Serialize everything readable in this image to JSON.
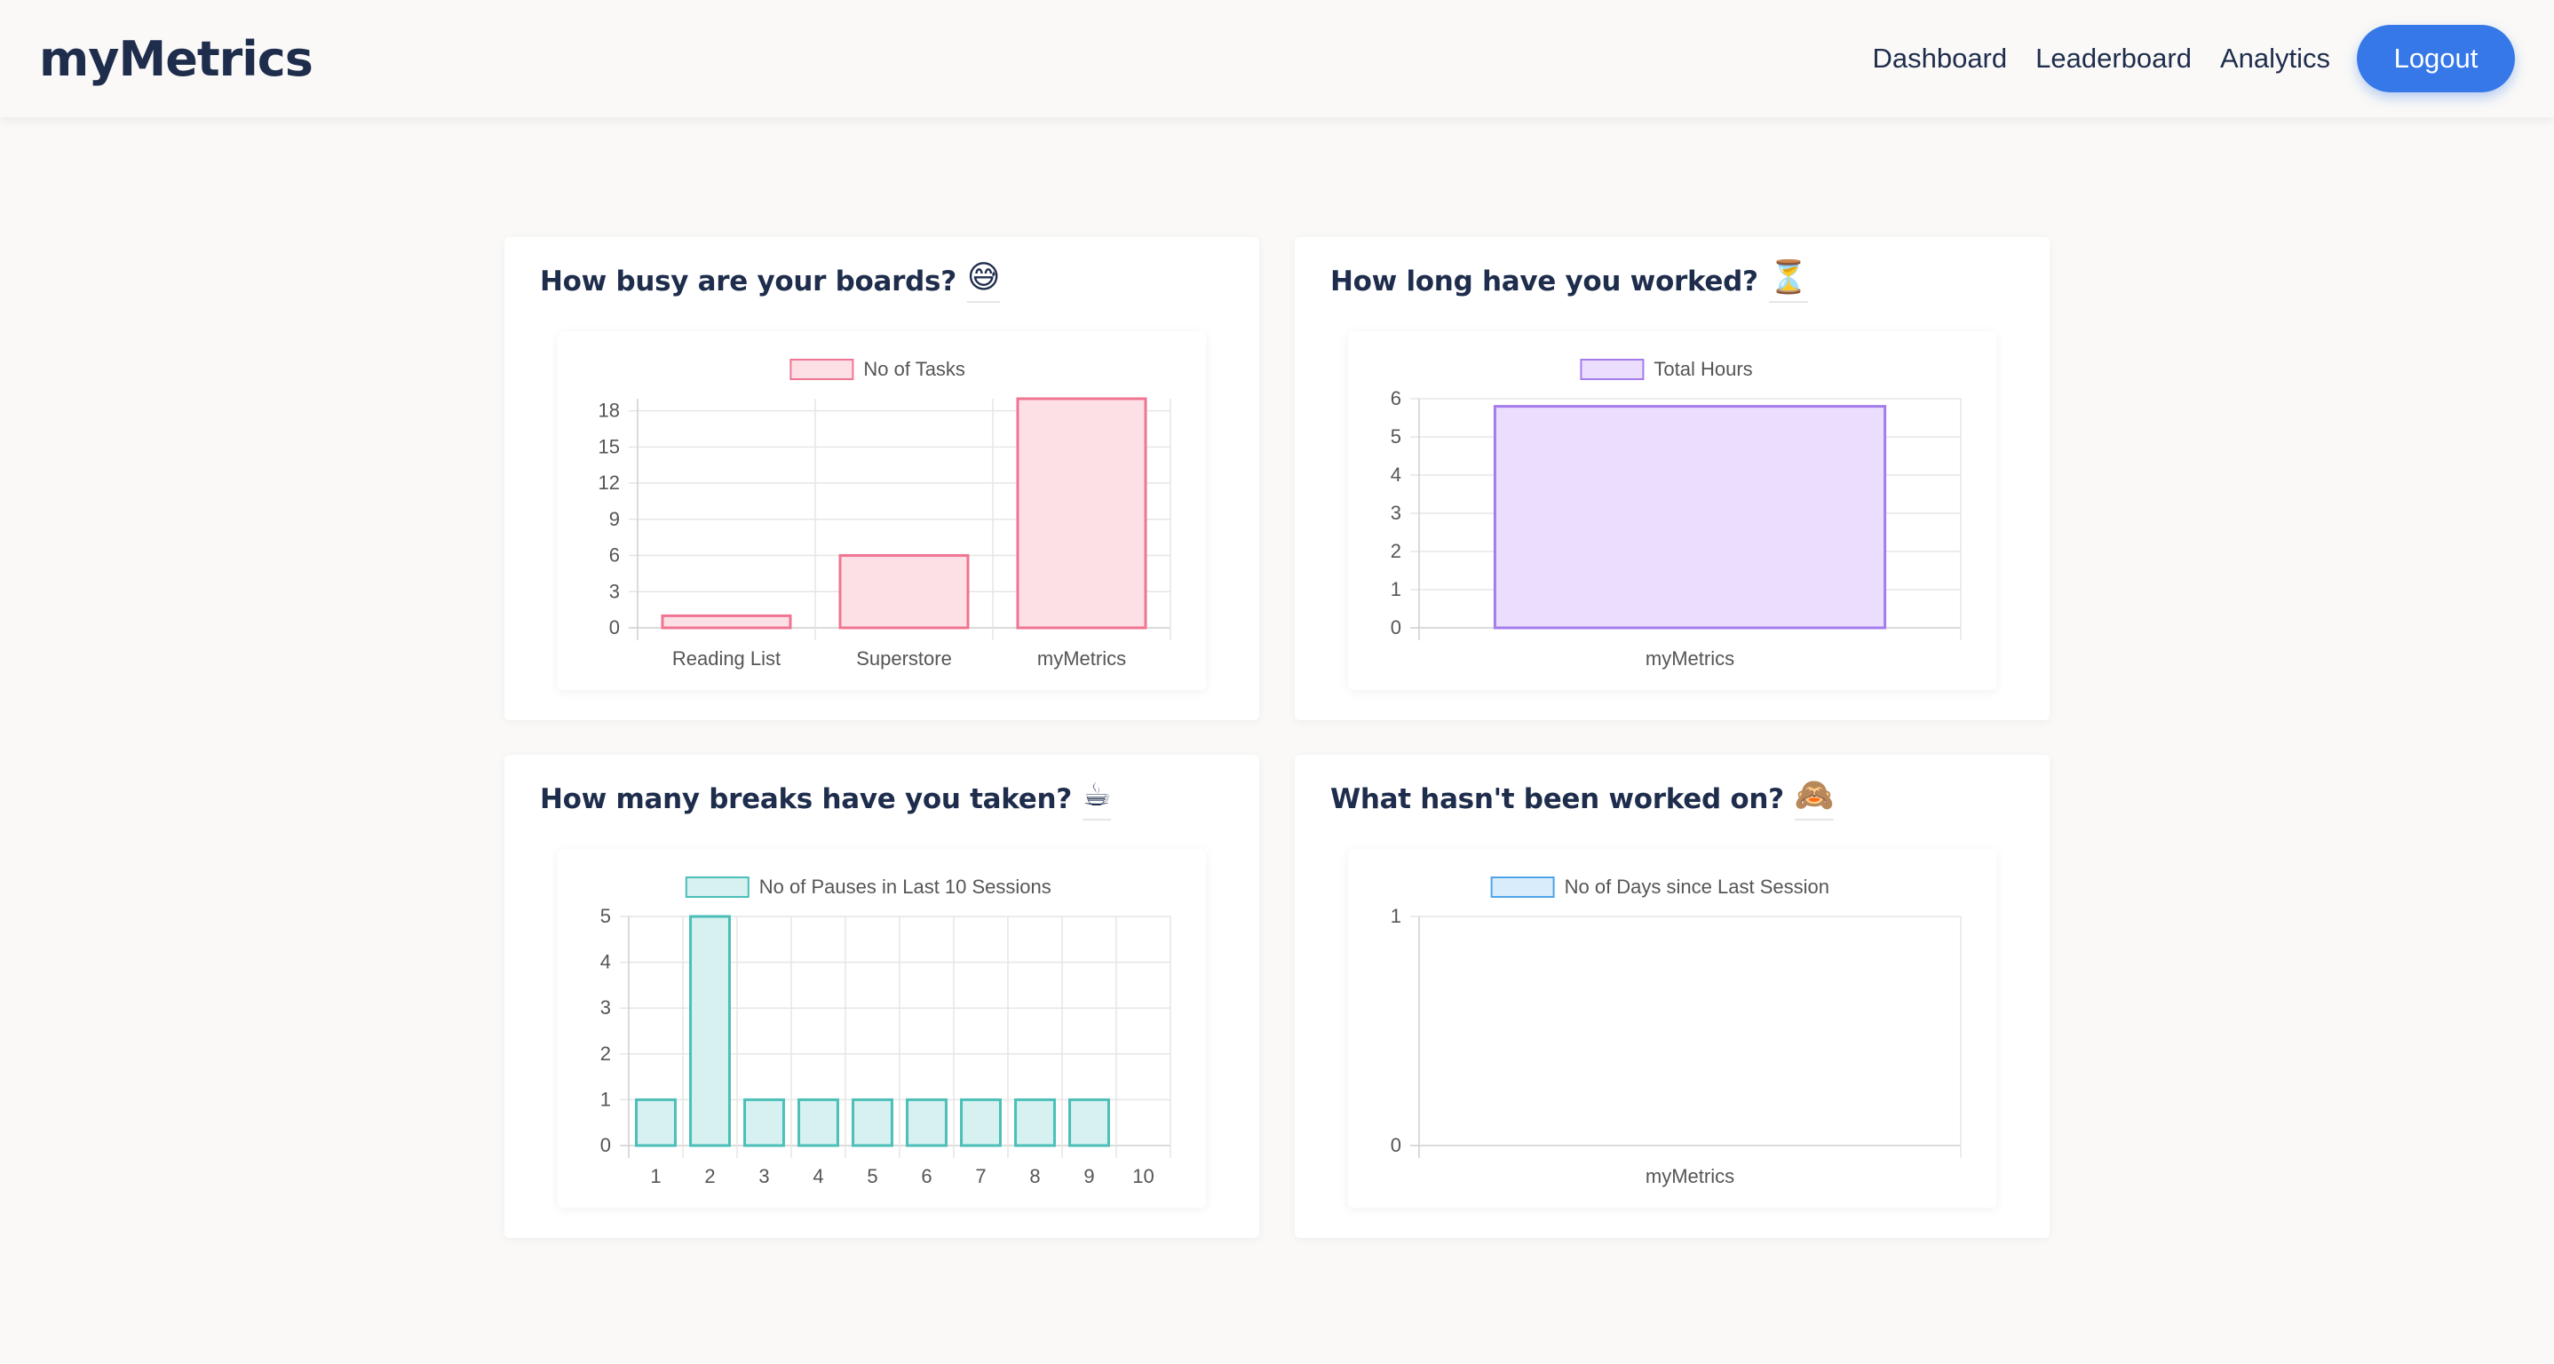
{
  "nav": {
    "brand": "myMetrics",
    "links": [
      "Dashboard",
      "Leaderboard",
      "Analytics"
    ],
    "logout_label": "Logout",
    "accent": "#3678e8"
  },
  "cards": [
    {
      "title": "How busy are your boards?",
      "emoji": "😅"
    },
    {
      "title": "How long have you worked?",
      "emoji": "⏳"
    },
    {
      "title": "How many breaks have you taken?",
      "emoji": "☕"
    },
    {
      "title": "What hasn't been worked on?",
      "emoji": "🙈"
    }
  ],
  "chart_data": [
    {
      "type": "bar",
      "categories": [
        "Reading List",
        "Superstore",
        "myMetrics"
      ],
      "series": [
        {
          "name": "No of Tasks",
          "values": [
            1,
            6,
            19
          ]
        }
      ],
      "ylim": [
        0,
        19
      ],
      "yticks": [
        0,
        3,
        6,
        9,
        12,
        15,
        18
      ],
      "fill": "#fde0e6",
      "stroke": "#f07592",
      "grid": true,
      "legend": "top",
      "bar_ratio": 0.72
    },
    {
      "type": "bar",
      "categories": [
        "myMetrics"
      ],
      "series": [
        {
          "name": "Total Hours",
          "values": [
            5.8
          ]
        }
      ],
      "ylim": [
        0,
        6
      ],
      "yticks": [
        0,
        1,
        2,
        3,
        4,
        5,
        6
      ],
      "fill": "#ebdefc",
      "stroke": "#a57ceb",
      "grid": true,
      "legend": "top",
      "bar_ratio": 0.72
    },
    {
      "type": "bar",
      "categories": [
        "1",
        "2",
        "3",
        "4",
        "5",
        "6",
        "7",
        "8",
        "9",
        "10"
      ],
      "series": [
        {
          "name": "No of Pauses in Last 10 Sessions",
          "values": [
            1,
            5,
            1,
            1,
            1,
            1,
            1,
            1,
            1,
            0
          ]
        }
      ],
      "ylim": [
        0,
        5
      ],
      "yticks": [
        0,
        1,
        2,
        3,
        4,
        5
      ],
      "fill": "#d6f1f0",
      "stroke": "#4bbfb8",
      "grid": true,
      "legend": "top",
      "bar_ratio": 0.72
    },
    {
      "type": "bar",
      "categories": [
        "myMetrics"
      ],
      "series": [
        {
          "name": "No of Days since Last Session",
          "values": [
            0
          ]
        }
      ],
      "ylim": [
        0,
        1
      ],
      "yticks": [
        0,
        1
      ],
      "fill": "#d9ecfb",
      "stroke": "#4fa4e8",
      "grid": true,
      "legend": "top",
      "bar_ratio": 0.72
    }
  ]
}
